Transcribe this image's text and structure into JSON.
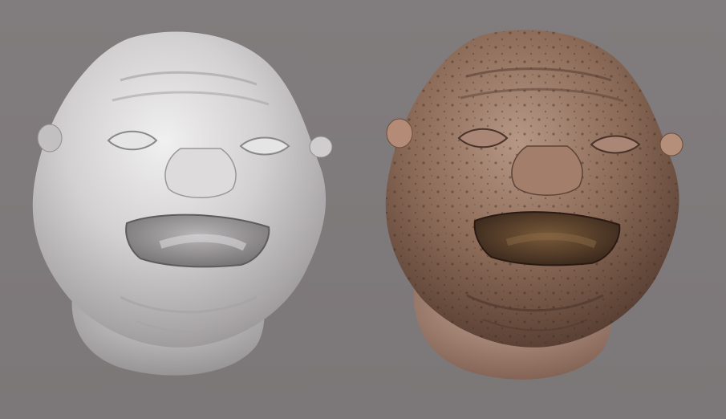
{
  "scene": {
    "background_color": "#7f7a7b",
    "renders": [
      {
        "name": "untextured-sculpt",
        "material": "clay",
        "base_color": "#c9c7c8"
      },
      {
        "name": "textured-sculpt",
        "material": "skin",
        "base_color": "#8b6a58"
      }
    ]
  }
}
